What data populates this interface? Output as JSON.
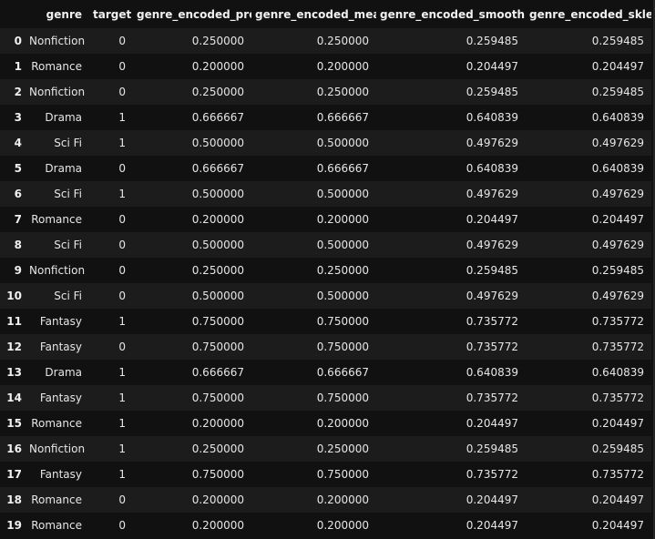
{
  "table": {
    "columns": [
      "",
      "genre",
      "target",
      "genre_encoded_prob",
      "genre_encoded_mean",
      "genre_encoded_smoothing",
      "genre_encoded_sklearn"
    ],
    "rows": [
      [
        "0",
        "Nonfiction",
        "0",
        "0.250000",
        "0.250000",
        "0.259485",
        "0.259485"
      ],
      [
        "1",
        "Romance",
        "0",
        "0.200000",
        "0.200000",
        "0.204497",
        "0.204497"
      ],
      [
        "2",
        "Nonfiction",
        "0",
        "0.250000",
        "0.250000",
        "0.259485",
        "0.259485"
      ],
      [
        "3",
        "Drama",
        "1",
        "0.666667",
        "0.666667",
        "0.640839",
        "0.640839"
      ],
      [
        "4",
        "Sci Fi",
        "1",
        "0.500000",
        "0.500000",
        "0.497629",
        "0.497629"
      ],
      [
        "5",
        "Drama",
        "0",
        "0.666667",
        "0.666667",
        "0.640839",
        "0.640839"
      ],
      [
        "6",
        "Sci Fi",
        "1",
        "0.500000",
        "0.500000",
        "0.497629",
        "0.497629"
      ],
      [
        "7",
        "Romance",
        "0",
        "0.200000",
        "0.200000",
        "0.204497",
        "0.204497"
      ],
      [
        "8",
        "Sci Fi",
        "0",
        "0.500000",
        "0.500000",
        "0.497629",
        "0.497629"
      ],
      [
        "9",
        "Nonfiction",
        "0",
        "0.250000",
        "0.250000",
        "0.259485",
        "0.259485"
      ],
      [
        "10",
        "Sci Fi",
        "0",
        "0.500000",
        "0.500000",
        "0.497629",
        "0.497629"
      ],
      [
        "11",
        "Fantasy",
        "1",
        "0.750000",
        "0.750000",
        "0.735772",
        "0.735772"
      ],
      [
        "12",
        "Fantasy",
        "0",
        "0.750000",
        "0.750000",
        "0.735772",
        "0.735772"
      ],
      [
        "13",
        "Drama",
        "1",
        "0.666667",
        "0.666667",
        "0.640839",
        "0.640839"
      ],
      [
        "14",
        "Fantasy",
        "1",
        "0.750000",
        "0.750000",
        "0.735772",
        "0.735772"
      ],
      [
        "15",
        "Romance",
        "1",
        "0.200000",
        "0.200000",
        "0.204497",
        "0.204497"
      ],
      [
        "16",
        "Nonfiction",
        "1",
        "0.250000",
        "0.250000",
        "0.259485",
        "0.259485"
      ],
      [
        "17",
        "Fantasy",
        "1",
        "0.750000",
        "0.750000",
        "0.735772",
        "0.735772"
      ],
      [
        "18",
        "Romance",
        "0",
        "0.200000",
        "0.200000",
        "0.204497",
        "0.204497"
      ],
      [
        "19",
        "Romance",
        "0",
        "0.200000",
        "0.200000",
        "0.204497",
        "0.204497"
      ]
    ]
  },
  "colors": {
    "background": "#111111",
    "row_alt": "#1c1c1c",
    "text": "#e6e6e6"
  }
}
